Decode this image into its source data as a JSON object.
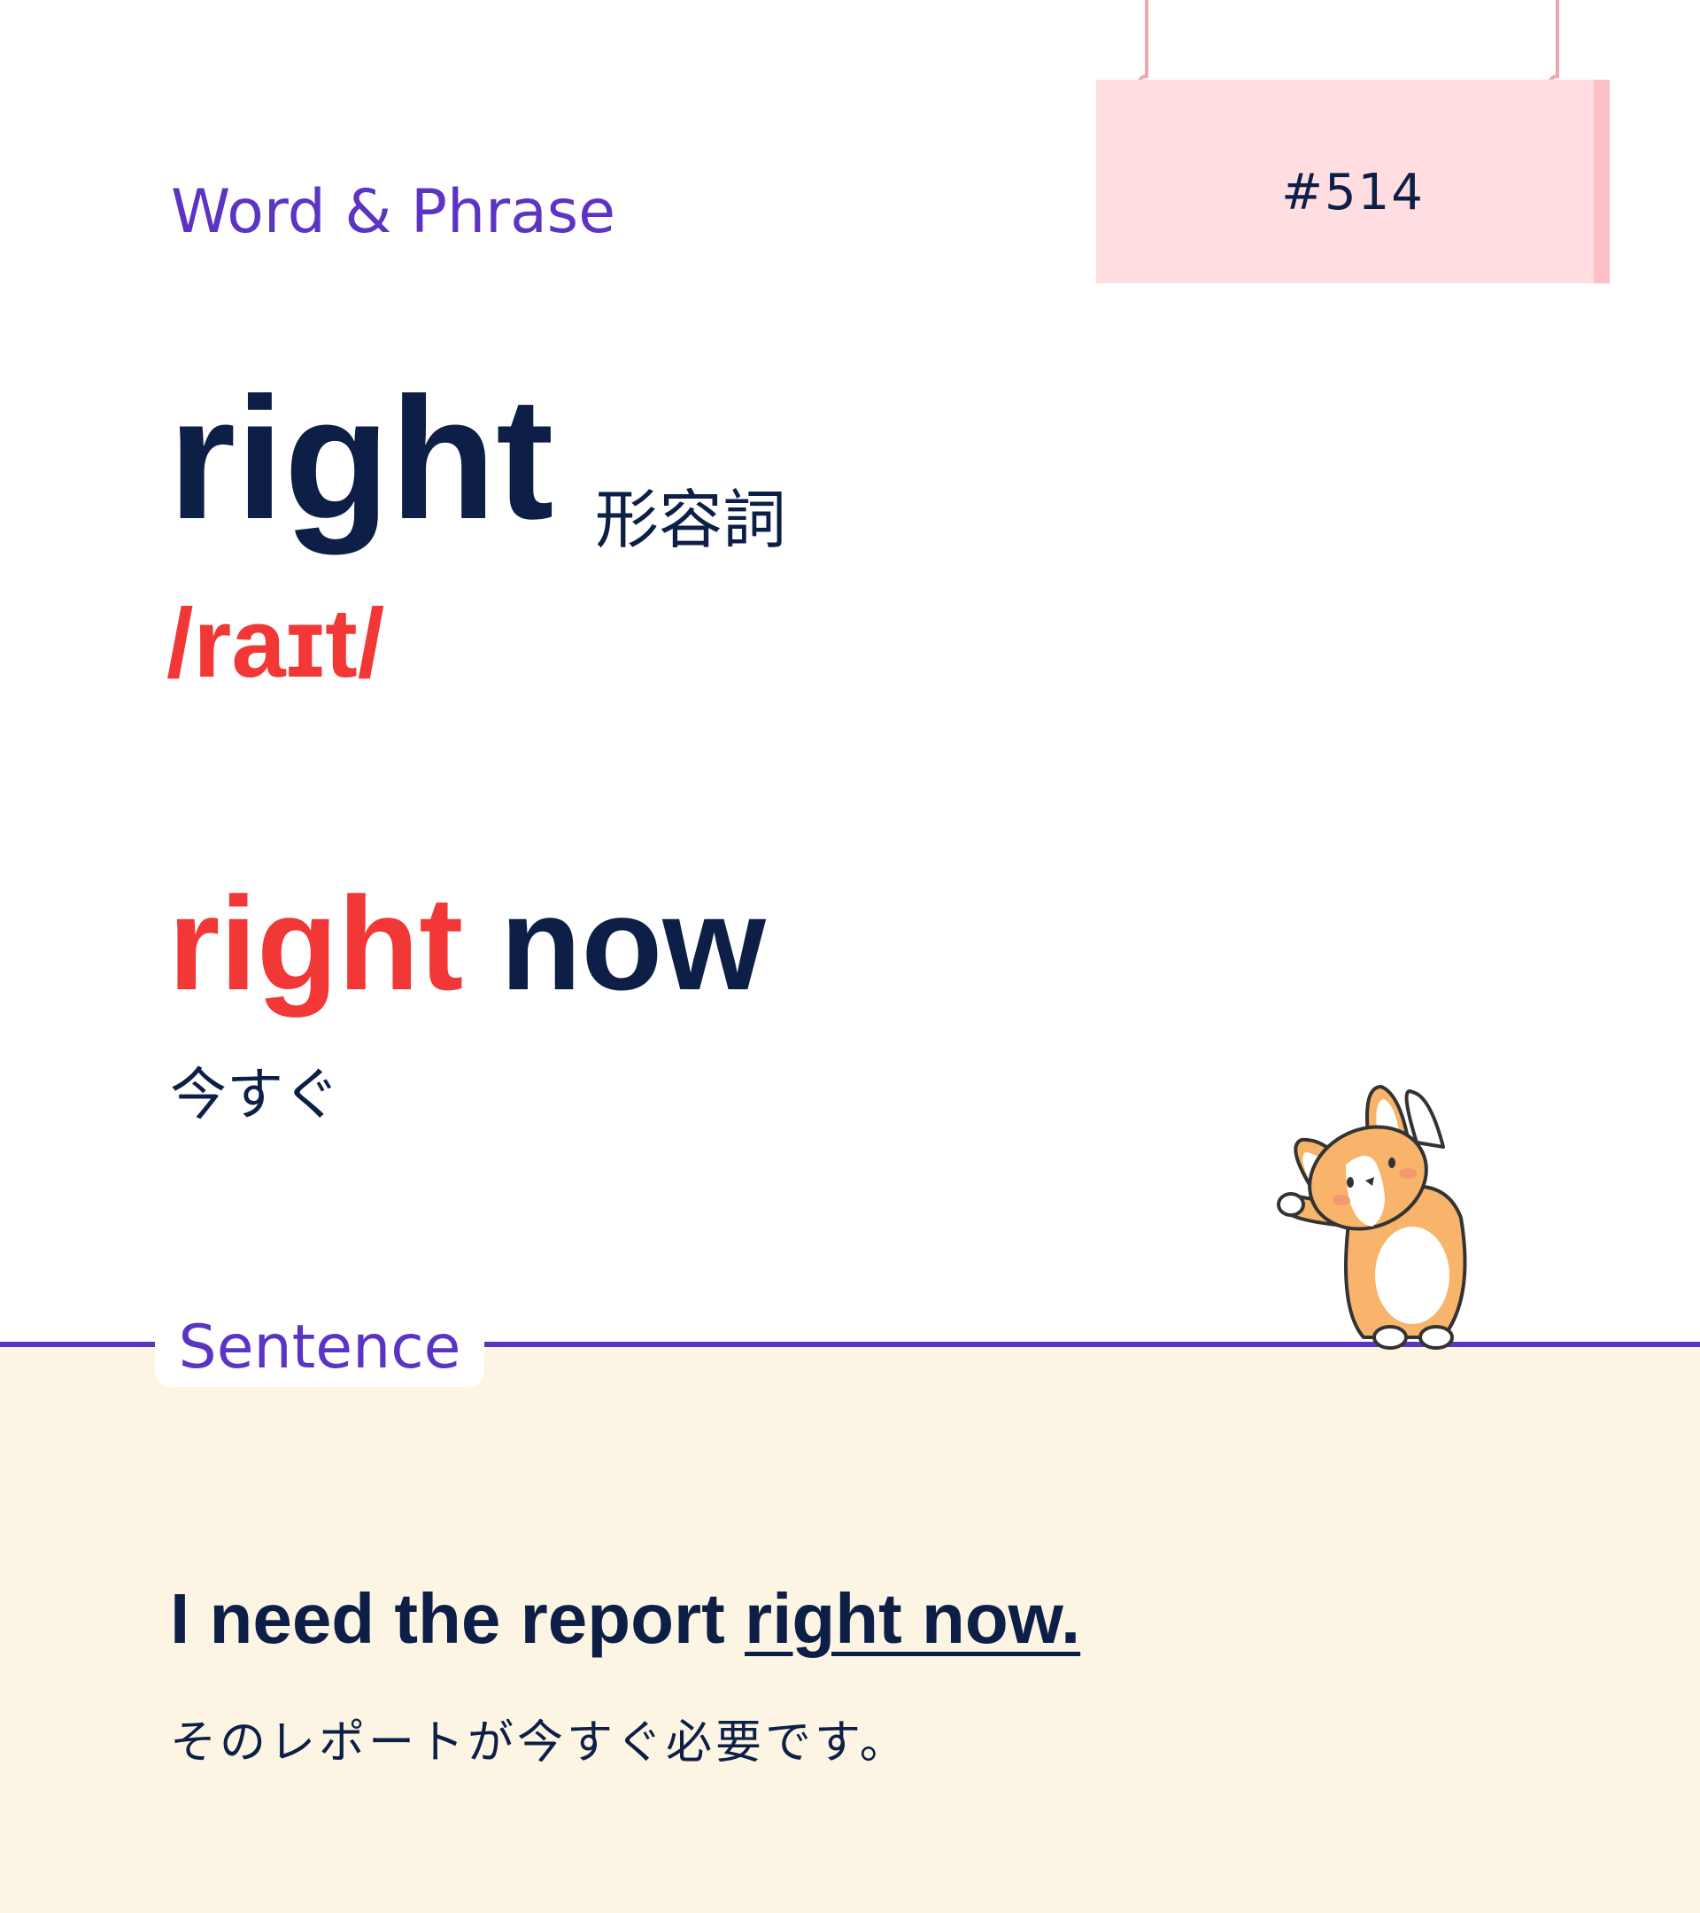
{
  "card": {
    "category_label": "Word & Phrase",
    "number": "#514",
    "headword": "right",
    "part_of_speech": "形容詞",
    "pronunciation": "/raɪt/",
    "phrase": {
      "highlight": "right",
      "rest": " now",
      "meaning": "今すぐ"
    },
    "sentence_section": {
      "label": "Sentence",
      "text_before": "I need the report ",
      "text_underlined": "right now.",
      "translation": "そのレポートが今すぐ必要です。"
    },
    "mascot": "corgi-illustration",
    "colors": {
      "accent_purple": "#5b34c4",
      "highlight_red": "#f23737",
      "navy_text": "#0d1f47",
      "sign_pink": "#ffdde1",
      "panel_cream": "#fdf5e4"
    }
  }
}
